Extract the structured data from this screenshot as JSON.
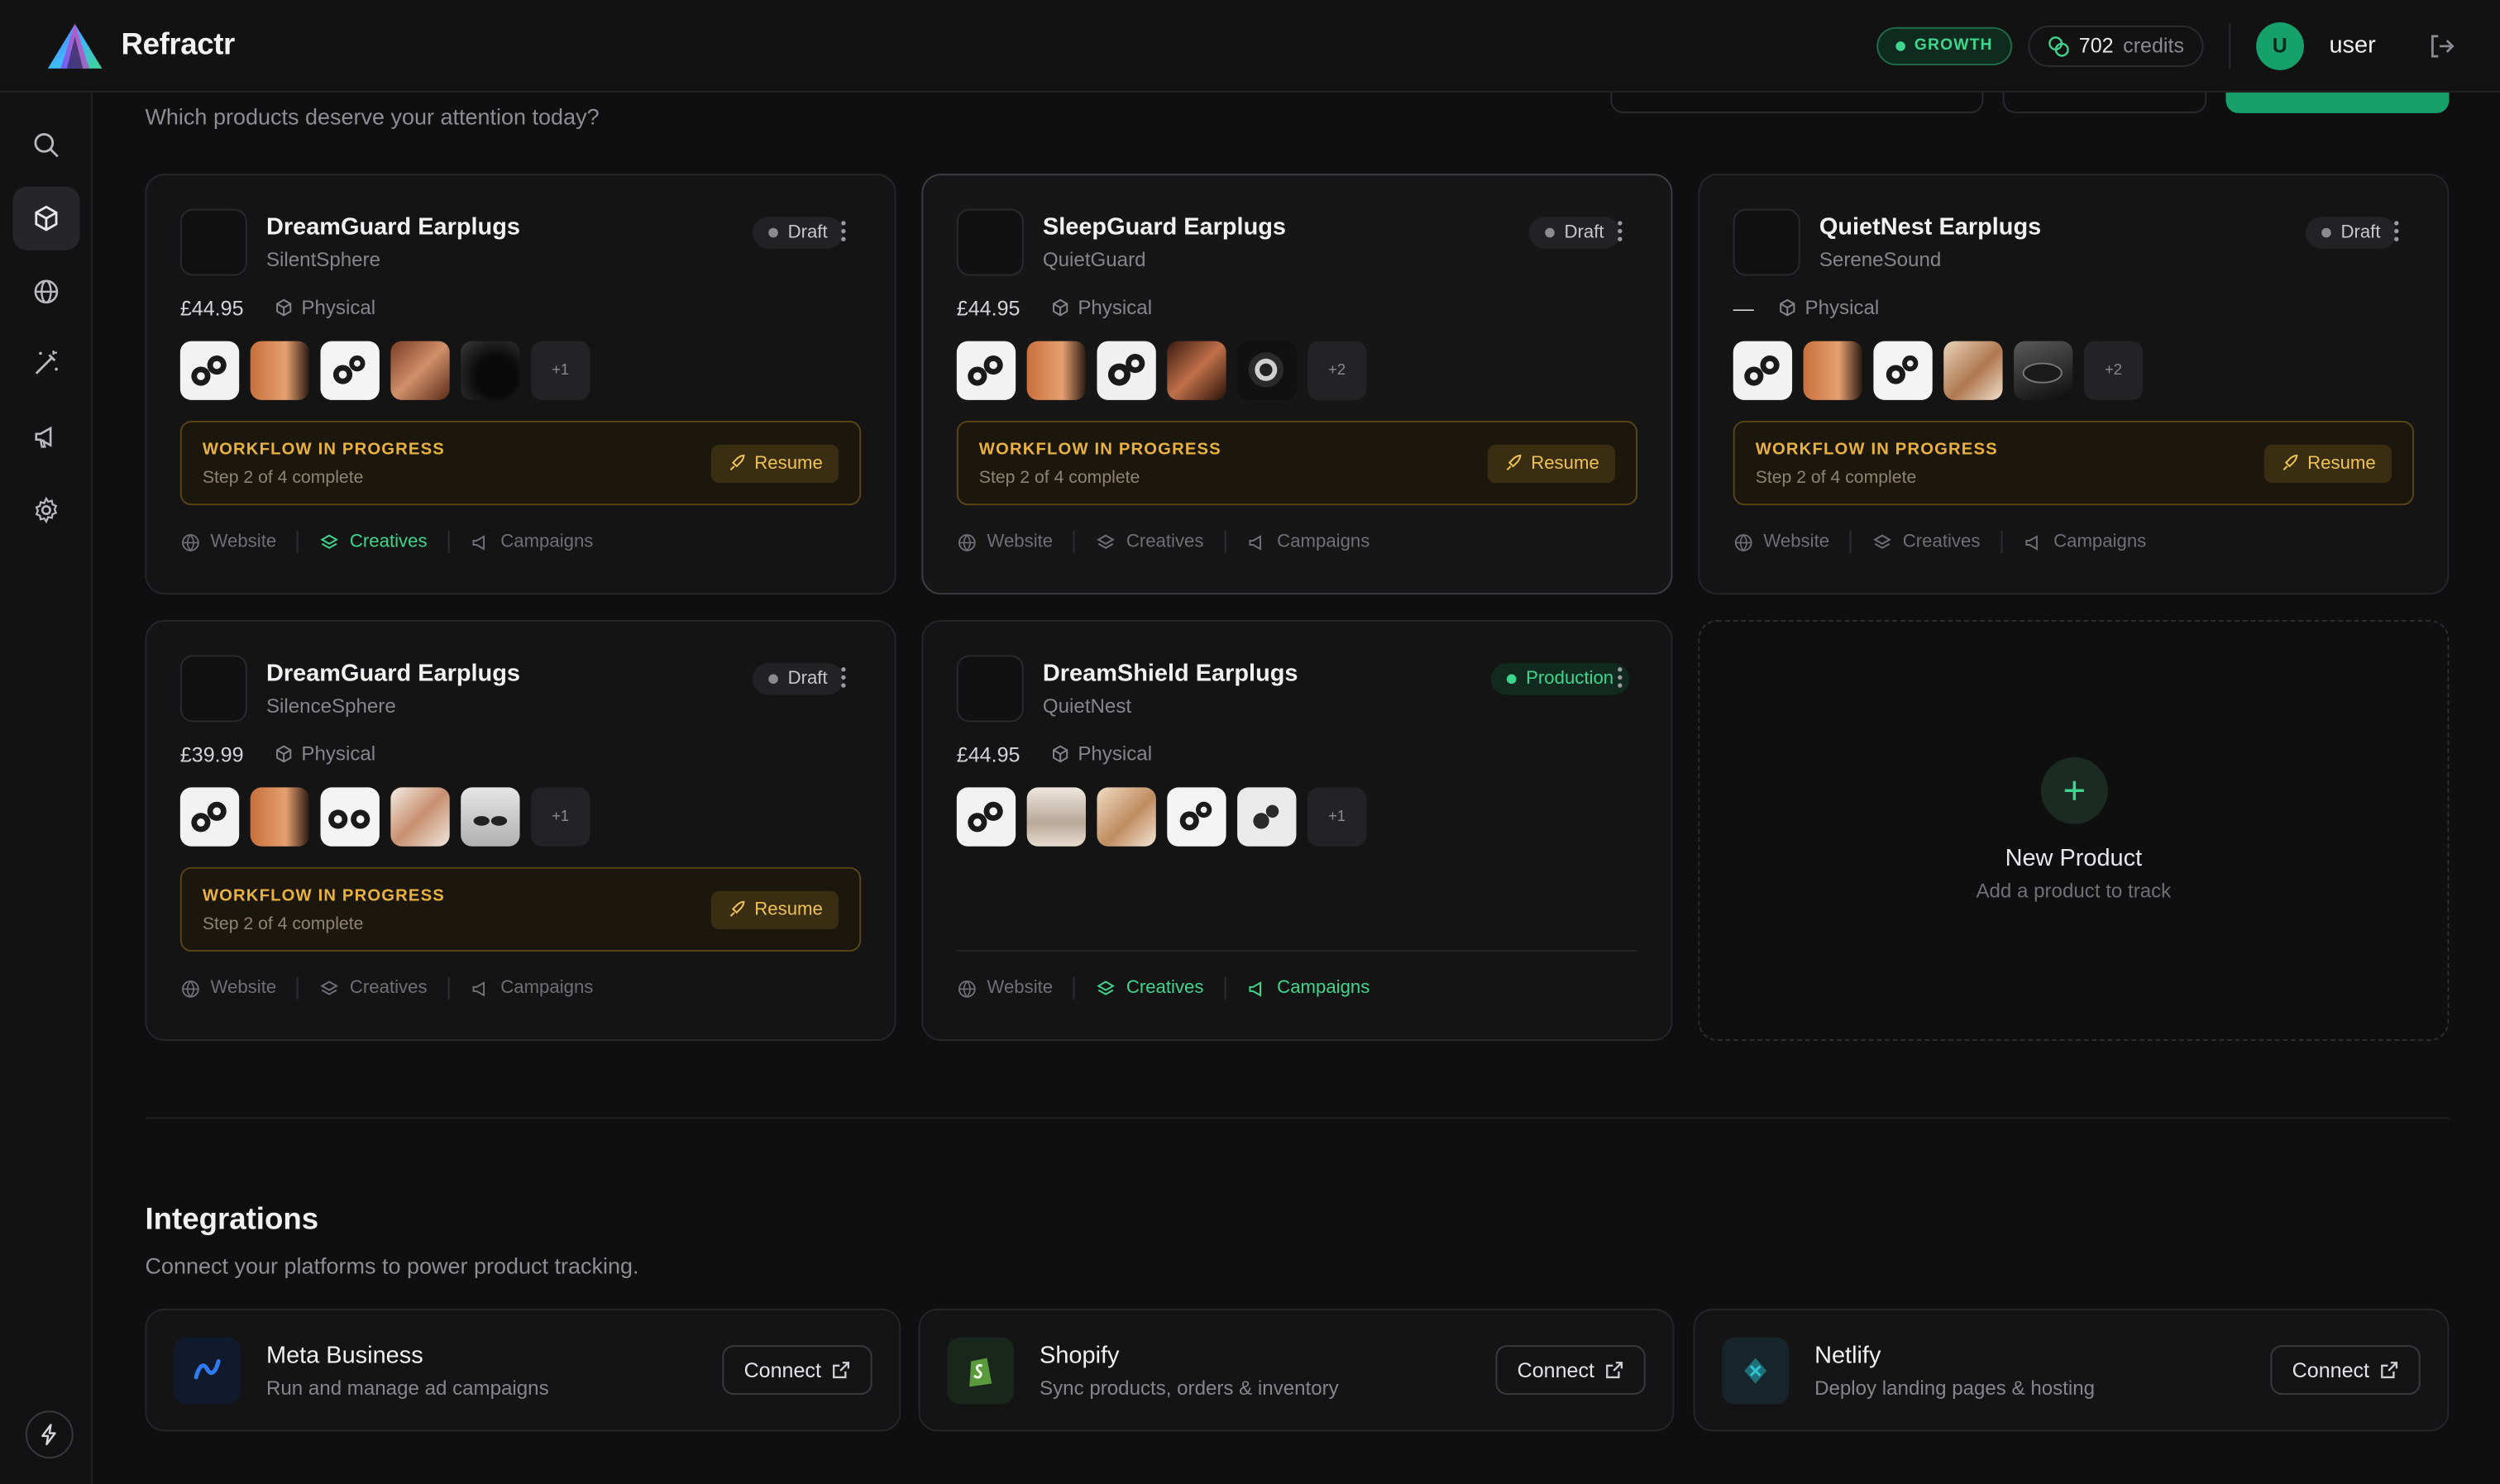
{
  "app": {
    "name": "Refractr"
  },
  "topbar": {
    "plan": "GROWTH",
    "credits_value": "702",
    "credits_label": "credits",
    "avatar_initial": "U",
    "username": "user"
  },
  "page": {
    "subtitle": "Which products deserve your attention today?"
  },
  "products": [
    {
      "name": "DreamGuard Earplugs",
      "brand": "SilentSphere",
      "status": "Draft",
      "price": "£44.95",
      "type": "Physical",
      "more": "+1",
      "workflow_title": "WORKFLOW IN PROGRESS",
      "workflow_step": "Step 2 of 4 complete",
      "resume": "Resume",
      "links": [
        "Website",
        "Creatives",
        "Campaigns"
      ]
    },
    {
      "name": "SleepGuard Earplugs",
      "brand": "QuietGuard",
      "status": "Draft",
      "price": "£44.95",
      "type": "Physical",
      "more": "+2",
      "workflow_title": "WORKFLOW IN PROGRESS",
      "workflow_step": "Step 2 of 4 complete",
      "resume": "Resume",
      "links": [
        "Website",
        "Creatives",
        "Campaigns"
      ]
    },
    {
      "name": "QuietNest Earplugs",
      "brand": "SereneSound",
      "status": "Draft",
      "price": "—",
      "type": "Physical",
      "more": "+2",
      "workflow_title": "WORKFLOW IN PROGRESS",
      "workflow_step": "Step 2 of 4 complete",
      "resume": "Resume",
      "links": [
        "Website",
        "Creatives",
        "Campaigns"
      ]
    },
    {
      "name": "DreamGuard Earplugs",
      "brand": "SilenceSphere",
      "status": "Draft",
      "price": "£39.99",
      "type": "Physical",
      "more": "+1",
      "workflow_title": "WORKFLOW IN PROGRESS",
      "workflow_step": "Step 2 of 4 complete",
      "resume": "Resume",
      "links": [
        "Website",
        "Creatives",
        "Campaigns"
      ]
    },
    {
      "name": "DreamShield Earplugs",
      "brand": "QuietNest",
      "status": "Production",
      "price": "£44.95",
      "type": "Physical",
      "more": "+1",
      "links": [
        "Website",
        "Creatives",
        "Campaigns"
      ]
    }
  ],
  "new_product": {
    "title": "New Product",
    "subtitle": "Add a product to track"
  },
  "integrations": {
    "title": "Integrations",
    "subtitle": "Connect your platforms to power product tracking.",
    "items": [
      {
        "name": "Meta Business",
        "desc": "Run and manage ad campaigns",
        "action": "Connect"
      },
      {
        "name": "Shopify",
        "desc": "Sync products, orders & inventory",
        "action": "Connect"
      },
      {
        "name": "Netlify",
        "desc": "Deploy landing pages & hosting",
        "action": "Connect"
      }
    ]
  },
  "colors": {
    "accent": "#3dd68c",
    "warning": "#e9b23f",
    "background": "#0f0f10"
  }
}
